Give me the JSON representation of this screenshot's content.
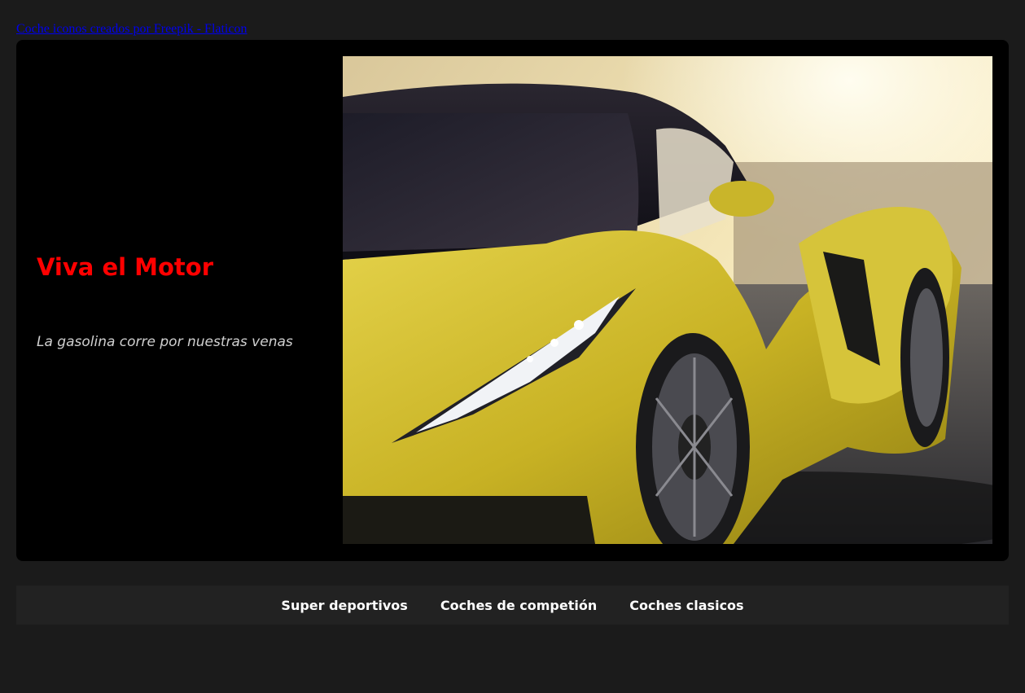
{
  "attribution": {
    "link_text": "Coche iconos creados por Freepik - Flaticon"
  },
  "hero": {
    "title": "Viva el Motor",
    "subtitle": "La gasolina corre por nuestras venas"
  },
  "nav": {
    "items": [
      {
        "label": "Super deportivos"
      },
      {
        "label": "Coches de competión"
      },
      {
        "label": "Coches clasicos"
      }
    ]
  },
  "colors": {
    "page_background": "#1b1b1b",
    "hero_background": "#000000",
    "title_color": "#ff0000",
    "nav_background": "#222222",
    "link_color": "#0000ee"
  }
}
